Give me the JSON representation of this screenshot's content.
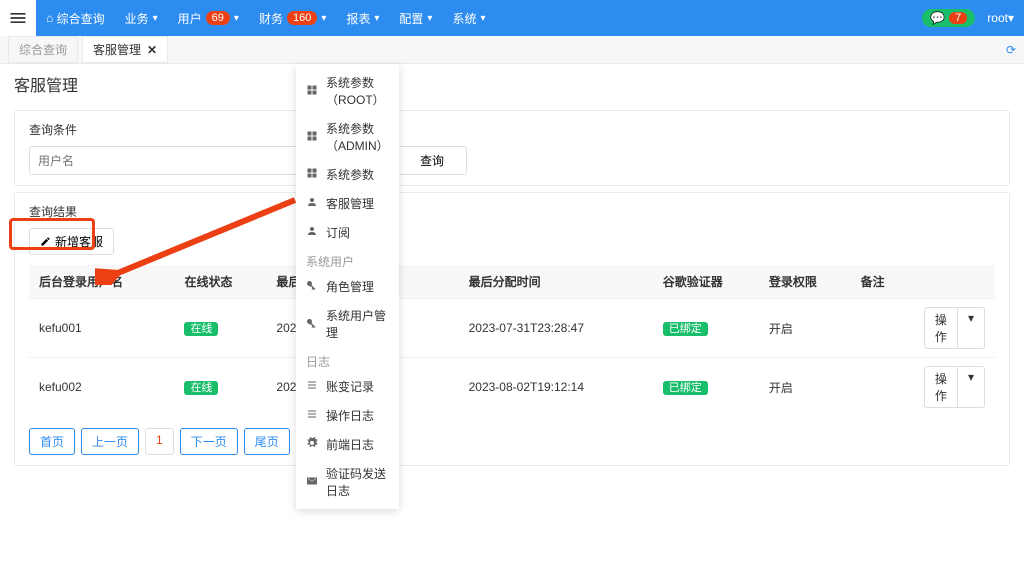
{
  "topnav": {
    "home": "综合查询",
    "items": [
      {
        "label": "业务"
      },
      {
        "label": "用户",
        "badge": "69"
      },
      {
        "label": "财务",
        "badge": "160"
      },
      {
        "label": "报表"
      },
      {
        "label": "配置"
      },
      {
        "label": "系统"
      }
    ],
    "chat_count": "7",
    "user": "root"
  },
  "tabs": {
    "inactive": "综合查询",
    "active": "客服管理"
  },
  "page_title": "客服管理",
  "search": {
    "title": "查询条件",
    "placeholder": "用户名",
    "button": "查询"
  },
  "results": {
    "title": "查询结果",
    "add_button": "新增客服",
    "columns": [
      "后台登录用户名",
      "在线状态",
      "最后上线",
      "最后分配时间",
      "谷歌验证器",
      "登录权限",
      "备注",
      ""
    ],
    "rows": [
      {
        "user": "kefu001",
        "status": "在线",
        "last_online": "2023-04",
        "last_assign": "2023-07-31T23:28:47",
        "ga": "已绑定",
        "login": "开启",
        "remark": "",
        "action": "操作"
      },
      {
        "user": "kefu002",
        "status": "在线",
        "last_online": "2023-04",
        "last_assign": "2023-08-02T19:12:14",
        "ga": "已绑定",
        "login": "开启",
        "remark": "",
        "action": "操作"
      }
    ],
    "pager": {
      "first": "首页",
      "prev": "上一页",
      "num": "1",
      "next": "下一页",
      "last": "尾页"
    }
  },
  "dropdown": {
    "items1": [
      {
        "label": "系统参数（ROOT）",
        "icon": "grid"
      },
      {
        "label": "系统参数（ADMIN）",
        "icon": "grid"
      },
      {
        "label": "系统参数",
        "icon": "grid"
      },
      {
        "label": "客服管理",
        "icon": "user",
        "highlighted": true
      },
      {
        "label": "订阅",
        "icon": "user"
      }
    ],
    "group1": "系统用户",
    "items2": [
      {
        "label": "角色管理",
        "icon": "key"
      },
      {
        "label": "系统用户管理",
        "icon": "key"
      }
    ],
    "group2": "日志",
    "items3": [
      {
        "label": "账变记录",
        "icon": "list"
      },
      {
        "label": "操作日志",
        "icon": "list"
      },
      {
        "label": "前端日志",
        "icon": "gear"
      },
      {
        "label": "验证码发送日志",
        "icon": "mail"
      }
    ]
  }
}
